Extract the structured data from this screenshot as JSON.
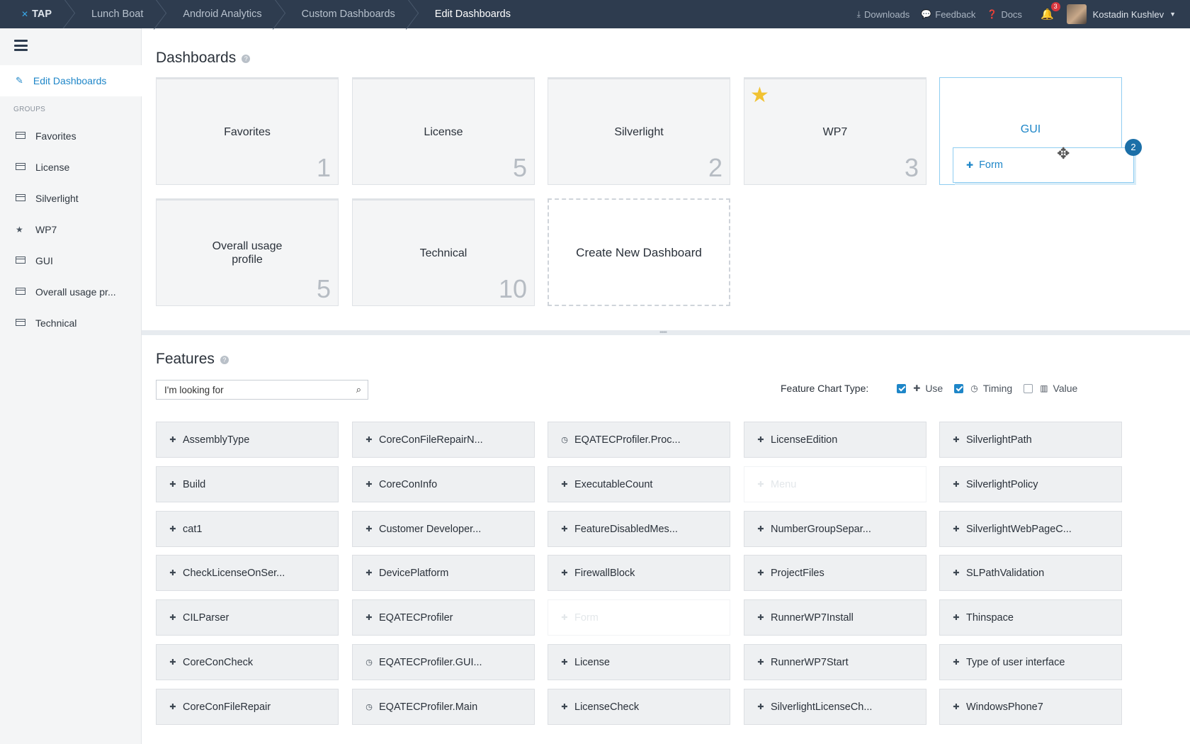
{
  "topbar": {
    "logo": "TAP",
    "breadcrumbs": [
      "Lunch Boat",
      "Android Analytics",
      "Custom Dashboards",
      "Edit Dashboards"
    ],
    "links": [
      {
        "label": "Downloads",
        "icon": "download-icon"
      },
      {
        "label": "Feedback",
        "icon": "chat-icon"
      },
      {
        "label": "Docs",
        "icon": "help-circle-icon"
      }
    ],
    "notification_count": "3",
    "user_name": "Kostadin Kushlev"
  },
  "sidebar": {
    "active_item": "Edit Dashboards",
    "groups_label": "GROUPS",
    "items": [
      {
        "label": "Favorites",
        "icon": "table-icon"
      },
      {
        "label": "License",
        "icon": "table-icon"
      },
      {
        "label": "Silverlight",
        "icon": "table-icon"
      },
      {
        "label": "WP7",
        "icon": "star-icon"
      },
      {
        "label": "GUI",
        "icon": "table-icon"
      },
      {
        "label": "Overall usage pr...",
        "icon": "table-icon"
      },
      {
        "label": "Technical",
        "icon": "table-icon"
      }
    ]
  },
  "dashboards": {
    "title": "Dashboards",
    "cards": [
      {
        "name": "Favorites",
        "count": "1"
      },
      {
        "name": "License",
        "count": "5"
      },
      {
        "name": "Silverlight",
        "count": "2"
      },
      {
        "name": "WP7",
        "count": "3",
        "starred": true
      },
      {
        "name": "GUI",
        "count": ""
      },
      {
        "name": "Overall usage profile",
        "count": "5"
      },
      {
        "name": "Technical",
        "count": "10"
      }
    ],
    "create_label": "Create New Dashboard",
    "drag": {
      "label": "Form",
      "badge": "2"
    }
  },
  "features": {
    "title": "Features",
    "search_value": "I'm looking for",
    "chart_type_label": "Feature Chart Type:",
    "chart_types": [
      {
        "label": "Use",
        "checked": true,
        "icon": "puzzle-icon"
      },
      {
        "label": "Timing",
        "checked": true,
        "icon": "clock-icon"
      },
      {
        "label": "Value",
        "checked": false,
        "icon": "bar-chart-icon"
      }
    ],
    "columns": [
      [
        {
          "label": "AssemblyType",
          "icon": "puzzle"
        },
        {
          "label": "Build",
          "icon": "puzzle"
        },
        {
          "label": "cat1",
          "icon": "puzzle"
        },
        {
          "label": "CheckLicenseOnSer...",
          "icon": "puzzle"
        },
        {
          "label": "CILParser",
          "icon": "puzzle"
        },
        {
          "label": "CoreConCheck",
          "icon": "puzzle"
        },
        {
          "label": "CoreConFileRepair",
          "icon": "puzzle"
        }
      ],
      [
        {
          "label": "CoreConFileRepairN...",
          "icon": "puzzle"
        },
        {
          "label": "CoreConInfo",
          "icon": "puzzle"
        },
        {
          "label": "Customer Developer...",
          "icon": "puzzle"
        },
        {
          "label": "DevicePlatform",
          "icon": "puzzle"
        },
        {
          "label": "EQATECProfiler",
          "icon": "puzzle"
        },
        {
          "label": "EQATECProfiler.GUI...",
          "icon": "clock"
        },
        {
          "label": "EQATECProfiler.Main",
          "icon": "clock"
        }
      ],
      [
        {
          "label": "EQATECProfiler.Proc...",
          "icon": "clock"
        },
        {
          "label": "ExecutableCount",
          "icon": "puzzle"
        },
        {
          "label": "FeatureDisabledMes...",
          "icon": "puzzle"
        },
        {
          "label": "FirewallBlock",
          "icon": "puzzle"
        },
        {
          "label": "Form",
          "icon": "puzzle",
          "ghost": true
        },
        {
          "label": "License",
          "icon": "puzzle"
        },
        {
          "label": "LicenseCheck",
          "icon": "puzzle"
        }
      ],
      [
        {
          "label": "LicenseEdition",
          "icon": "puzzle"
        },
        {
          "label": "Menu",
          "icon": "puzzle",
          "ghost": true
        },
        {
          "label": "NumberGroupSepar...",
          "icon": "puzzle"
        },
        {
          "label": "ProjectFiles",
          "icon": "puzzle"
        },
        {
          "label": "RunnerWP7Install",
          "icon": "puzzle"
        },
        {
          "label": "RunnerWP7Start",
          "icon": "puzzle"
        },
        {
          "label": "SilverlightLicenseCh...",
          "icon": "puzzle"
        }
      ],
      [
        {
          "label": "SilverlightPath",
          "icon": "puzzle"
        },
        {
          "label": "SilverlightPolicy",
          "icon": "puzzle"
        },
        {
          "label": "SilverlightWebPageC...",
          "icon": "puzzle"
        },
        {
          "label": "SLPathValidation",
          "icon": "puzzle"
        },
        {
          "label": "Thinspace",
          "icon": "puzzle"
        },
        {
          "label": "Type of user interface",
          "icon": "puzzle"
        },
        {
          "label": "WindowsPhone7",
          "icon": "puzzle"
        }
      ]
    ]
  }
}
